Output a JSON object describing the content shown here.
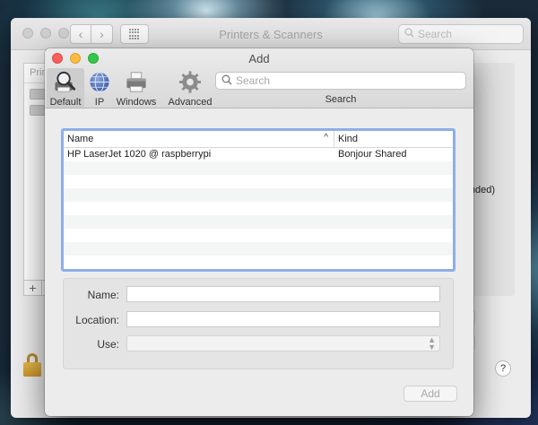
{
  "back_window": {
    "title": "Printers & Scanners",
    "search_placeholder": "Search",
    "list_header_partial": "Prin",
    "partial_text": "nded)",
    "add_symbol": "+",
    "help_symbol": "?"
  },
  "add_window": {
    "title": "Add",
    "toolbar": {
      "items": [
        {
          "label": "Default",
          "icon": "magnifier-printer-icon",
          "selected": true
        },
        {
          "label": "IP",
          "icon": "globe-icon",
          "selected": false
        },
        {
          "label": "Windows",
          "icon": "printer-icon",
          "selected": false
        },
        {
          "label": "Advanced",
          "icon": "gear-icon",
          "selected": false
        }
      ],
      "search_placeholder": "Search",
      "search_caption": "Search"
    },
    "list": {
      "columns": {
        "name": "Name",
        "kind": "Kind"
      },
      "sort_indicator": "^",
      "rows": [
        {
          "name": "HP LaserJet 1020 @ raspberrypi",
          "kind": "Bonjour Shared"
        }
      ]
    },
    "form": {
      "name_label": "Name:",
      "name_value": "",
      "location_label": "Location:",
      "location_value": "",
      "use_label": "Use:",
      "use_value": ""
    },
    "add_button": "Add"
  },
  "colors": {
    "close": "#fc605c",
    "minimize": "#fdbc40",
    "zoom": "#34c84a",
    "focus_ring": "#8faee6"
  }
}
